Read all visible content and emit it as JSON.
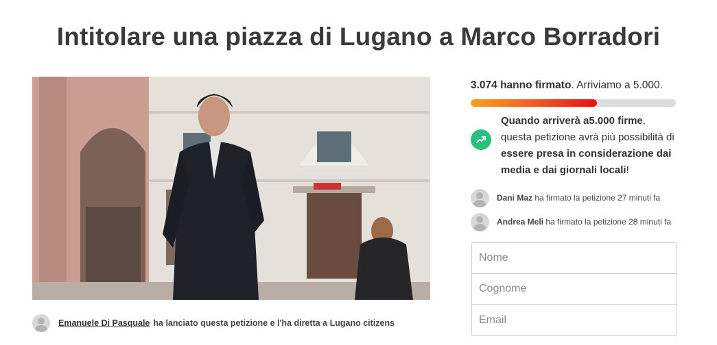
{
  "petition": {
    "title": "Intitolare una piazza di Lugano a Marco Borradori"
  },
  "starter": {
    "name": "Emanuele Di Pasquale",
    "text": "ha lanciato questa petizione e l'ha diretta a Lugano citizens"
  },
  "progress": {
    "count": "3.074 hanno firmato",
    "goal_text": ". Arriviamo a 5.000.",
    "fraction": 0.6148
  },
  "goal_message": {
    "bold1": "Quando arriverà a5.000 firme",
    "plain1": ", questa petizione avrà più possibilità di ",
    "bold2": "essere presa in considerazione dai media e dai giornali locali",
    "plain2": "!",
    "icon": "trending-up-icon"
  },
  "recent_signers": [
    {
      "name": "Dani Maz",
      "action": "ha firmato la petizione 27 minuti fa"
    },
    {
      "name": "Andrea Meli",
      "action": "ha firmato la petizione 28 minuti fa"
    }
  ],
  "form": {
    "first_name_placeholder": "Nome",
    "last_name_placeholder": "Cognome",
    "email_placeholder": "Email"
  },
  "colors": {
    "accent_green": "#27c07d",
    "progress_start": "#f7a21a",
    "progress_end": "#e81212"
  }
}
